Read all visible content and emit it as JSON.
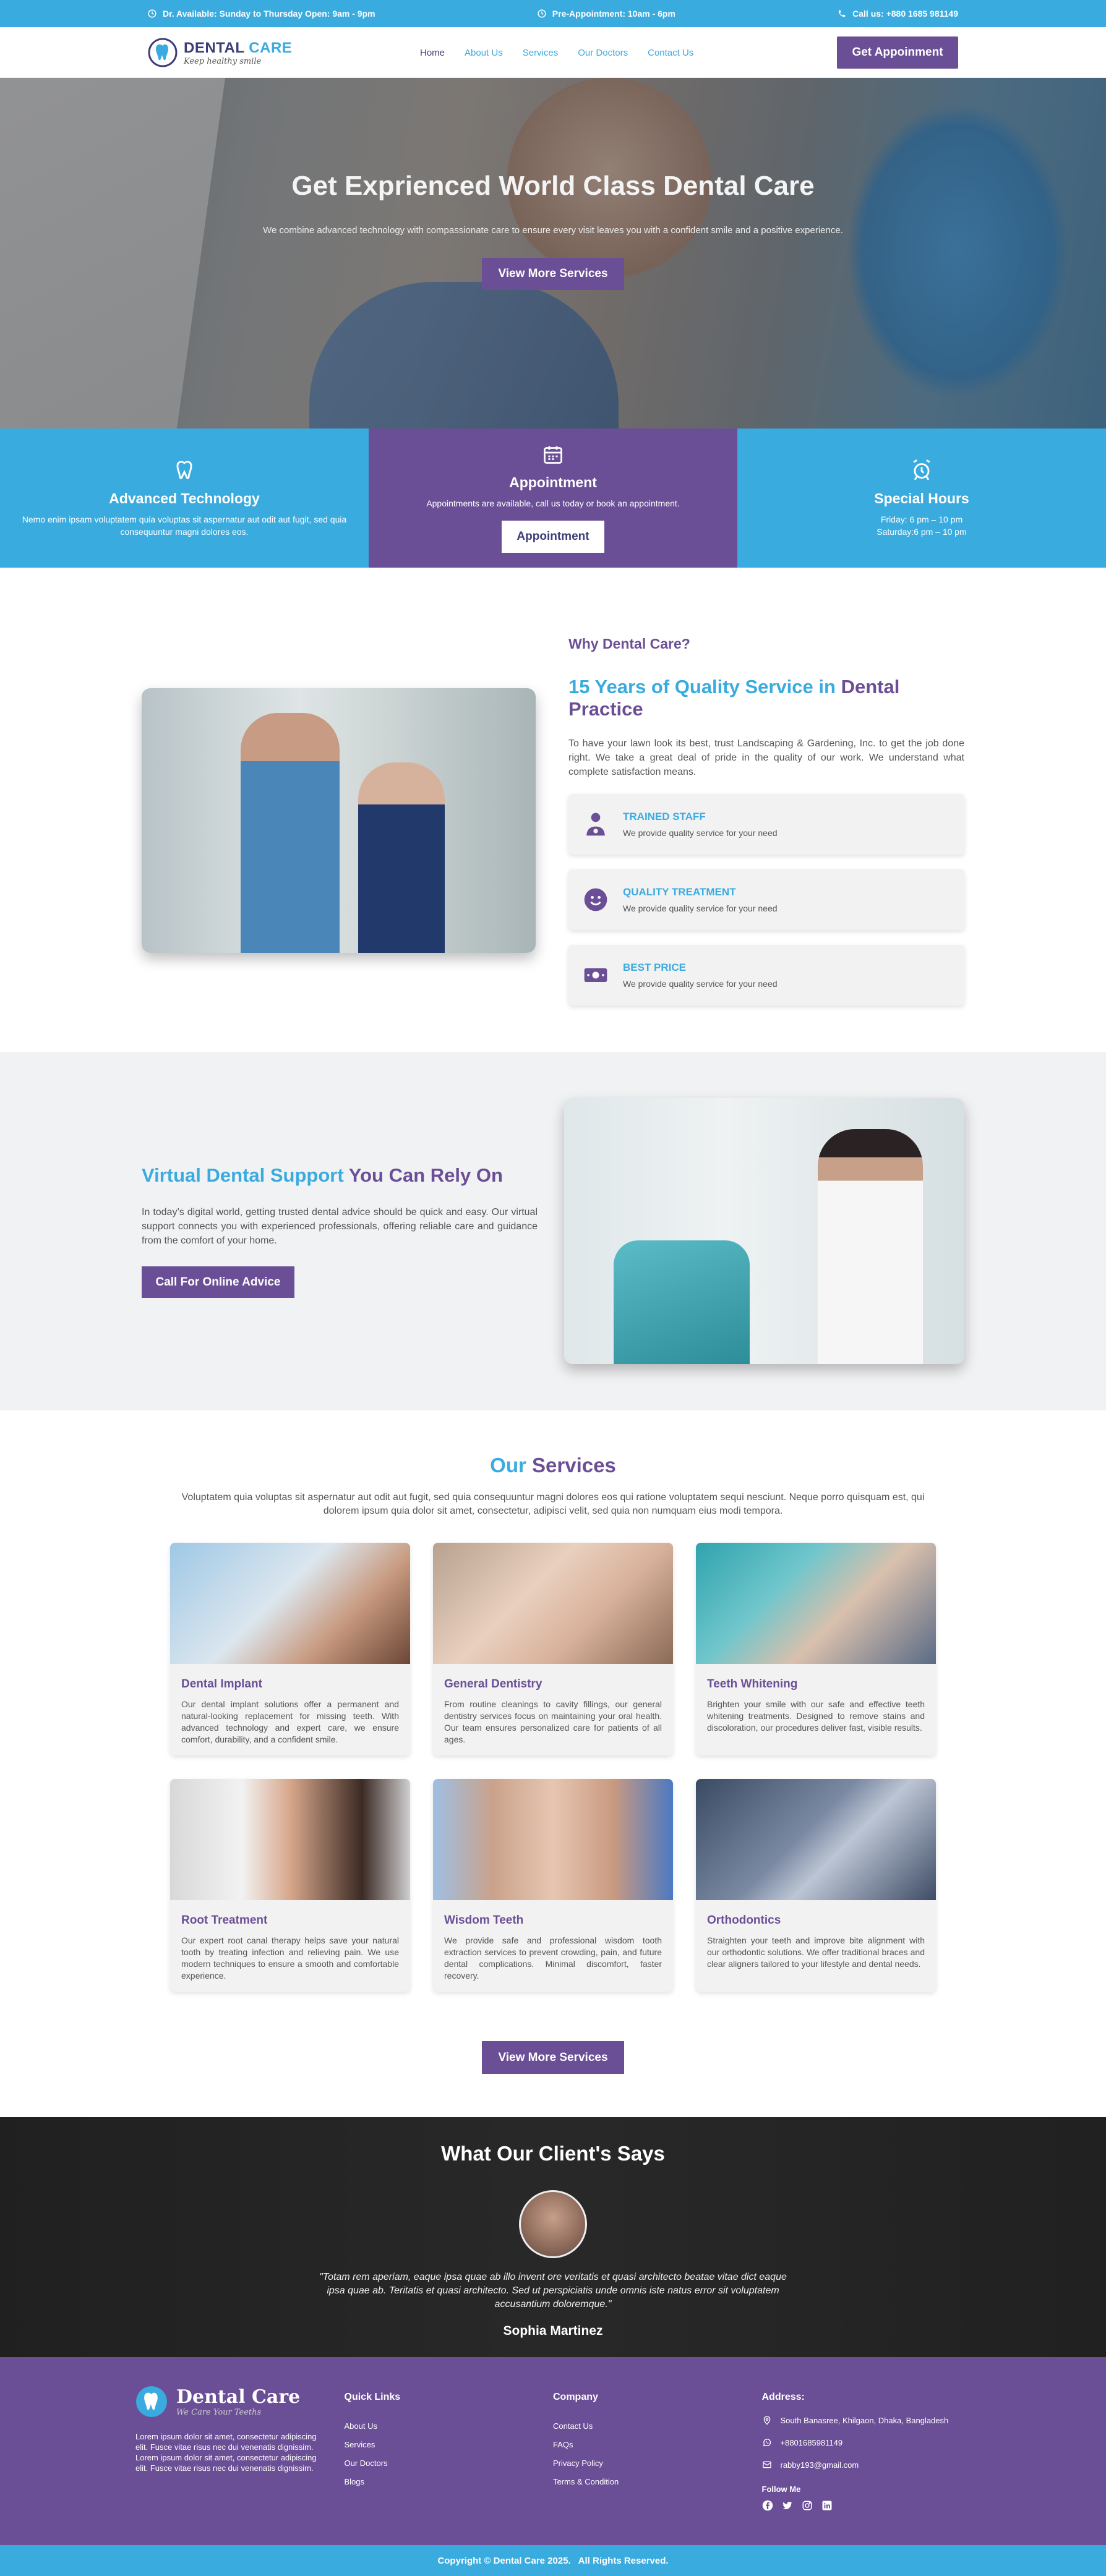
{
  "topbar": {
    "hours": "Dr. Available: Sunday to Thursday Open: 9am - 9pm",
    "pre_appointment": "Pre-Appointment: 10am - 6pm",
    "call": "Call us: +880 1685 981149"
  },
  "header": {
    "logo_dental": "DENTAL",
    "logo_care": "CARE",
    "logo_tagline": "Keep healthy smile",
    "nav": [
      "Home",
      "About Us",
      "Services",
      "Our Doctors",
      "Contact Us"
    ],
    "cta": "Get Appoinment"
  },
  "hero": {
    "title": "Get Exprienced World Class Dental Care",
    "subtitle": "We combine advanced technology with compassionate care to ensure every visit leaves you with a confident smile and a positive experience.",
    "button": "View More Services"
  },
  "features": [
    {
      "title": "Advanced Technology",
      "text": "Nemo enim ipsam voluptatem quia voluptas sit aspernatur aut odit aut fugit, sed quia consequuntur magni dolores eos."
    },
    {
      "title": "Appointment",
      "text": "Appointments are available, call us today or book an appointment.",
      "button": "Appointment"
    },
    {
      "title": "Special Hours",
      "line1": "Friday: 6 pm – 10 pm",
      "line2": "Saturday:6 pm – 10 pm"
    }
  ],
  "why": {
    "eyebrow": "Why Dental Care?",
    "heading_blue": "15 Years of Quality Service in",
    "heading_purple": "Dental Practice",
    "paragraph": "To have your lawn look its best, trust Landscaping & Gardening, Inc. to get the job done right. We take a great deal of pride in the quality of our work. We understand what complete satisfaction means.",
    "cards": [
      {
        "title": "TRAINED STAFF",
        "text": "We provide quality service for your need"
      },
      {
        "title": "QUALITY TREATMENT",
        "text": "We provide quality service for your need"
      },
      {
        "title": "BEST PRICE",
        "text": "We provide quality service for your need"
      }
    ]
  },
  "virtual": {
    "heading_blue": "Virtual Dental Support",
    "heading_purple": "You Can Rely On",
    "paragraph": "In today’s digital world, getting trusted dental advice should be quick and easy. Our virtual support connects you with experienced professionals, offering reliable care and guidance from the comfort of your home.",
    "button": "Call For Online Advice"
  },
  "services": {
    "heading_blue": "Our",
    "heading_purple": "Services",
    "intro": "Voluptatem quia voluptas sit aspernatur aut odit aut fugit, sed quia consequuntur magni dolores eos qui ratione voluptatem sequi nesciunt. Neque porro quisquam est, qui dolorem ipsum quia dolor sit amet, consectetur, adipisci velit, sed quia non numquam eius modi tempora.",
    "items": [
      {
        "title": "Dental Implant",
        "text": "Our dental implant solutions offer a permanent and natural-looking replacement for missing teeth. With advanced technology and expert care, we ensure comfort, durability, and a confident smile."
      },
      {
        "title": "General Dentistry",
        "text": "From routine cleanings to cavity fillings, our general dentistry services focus on maintaining your oral health. Our team ensures personalized care for patients of all ages."
      },
      {
        "title": "Teeth Whitening",
        "text": "Brighten your smile with our safe and effective teeth whitening treatments. Designed to remove stains and discoloration, our procedures deliver fast, visible results."
      },
      {
        "title": "Root Treatment",
        "text": "Our expert root canal therapy helps save your natural tooth by treating infection and relieving pain. We use modern techniques to ensure a smooth and comfortable experience."
      },
      {
        "title": "Wisdom Teeth",
        "text": "We provide safe and professional wisdom tooth extraction services to prevent crowding, pain, and future dental complications. Minimal discomfort, faster recovery."
      },
      {
        "title": "Orthodontics",
        "text": "Straighten your teeth and improve bite alignment with our orthodontic solutions. We offer traditional braces and clear aligners tailored to your lifestyle and dental needs."
      }
    ],
    "button": "View More Services"
  },
  "testimonial": {
    "heading_bold": "What",
    "heading_rest": "Our Client's Says",
    "quote": "\"Totam rem aperiam, eaque ipsa quae ab illo invent ore veritatis et quasi architecto beatae vitae dict eaque ipsa quae ab. Teritatis et quasi architecto. Sed ut perspiciatis unde omnis iste natus error sit voluptatem accusantium doloremque.\"",
    "name": "Sophia Martinez"
  },
  "footer": {
    "logo_name": "Dental Care",
    "logo_tag": "We Care Your Teeths",
    "about": "Lorem ipsum dolor sit amet, consectetur adipiscing elit. Fusce vitae risus nec dui venenatis dignissim. Lorem ipsum dolor sit amet, consectetur adipiscing elit. Fusce vitae risus nec dui venenatis dignissim.",
    "quick_links_title": "Quick Links",
    "quick_links": [
      "About Us",
      "Services",
      "Our Doctors",
      "Blogs"
    ],
    "company_title": "Company",
    "company_links": [
      "Contact Us",
      "FAQs",
      "Privacy Policy",
      "Terms & Condition"
    ],
    "address_title": "Address:",
    "address": "South Banasree, Khilgaon, Dhaka, Bangladesh",
    "phone": "+8801685981149",
    "email": "rabby193@gmail.com",
    "follow": "Follow Me",
    "copyright": "Copyright © Dental Care 2025.   All Rights Reserved."
  },
  "colors": {
    "blue": "#3aabdf",
    "purple": "#6b4f96",
    "navy": "#3d3d7a"
  }
}
